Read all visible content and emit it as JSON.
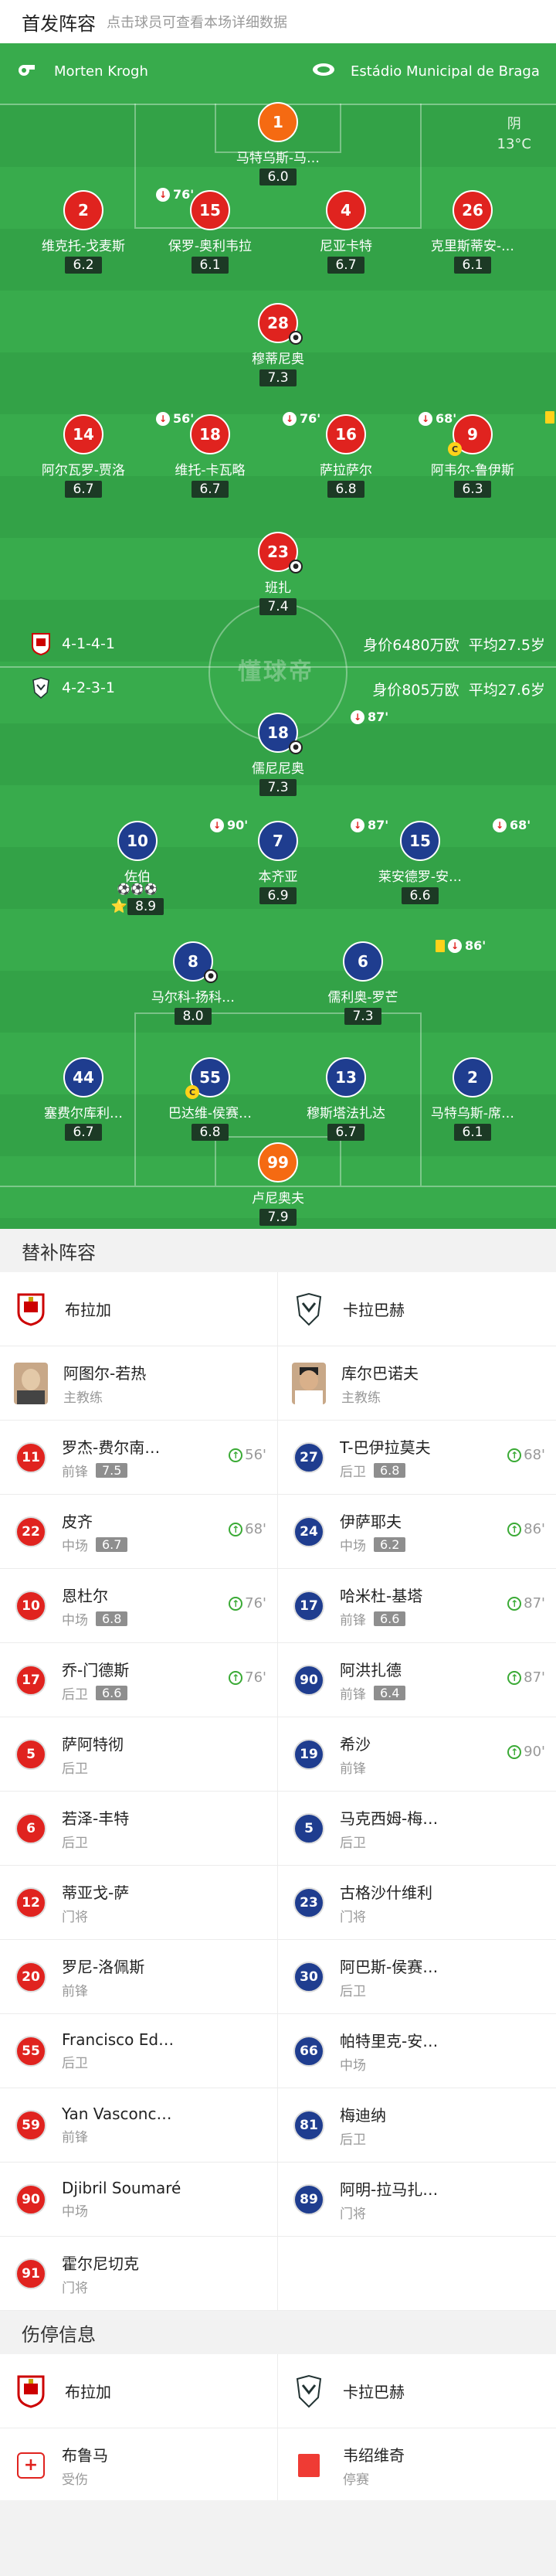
{
  "header": {
    "title": "首发阵容",
    "subtitle": "点击球员可查看本场详细数据"
  },
  "pitch": {
    "home_coach": "Morten Krogh",
    "venue": "Estádio Municipal de Braga",
    "weather": "阴",
    "temperature": "13°C",
    "watermark": "懂球帝",
    "home_formation": "4-1-4-1",
    "home_value": "身价6480万欧",
    "home_age": "平均27.5岁",
    "away_formation": "4-2-3-1",
    "away_value": "身价805万欧",
    "away_age": "平均27.6岁"
  },
  "home_players": [
    {
      "num": "1",
      "name": "马特乌斯-马…",
      "rating": "6.0",
      "color": "org"
    },
    {
      "num": "2",
      "name": "维克托-戈麦斯",
      "rating": "6.2",
      "sub": "76'"
    },
    {
      "num": "15",
      "name": "保罗-奥利韦拉",
      "rating": "6.1"
    },
    {
      "num": "4",
      "name": "尼亚卡特",
      "rating": "6.7"
    },
    {
      "num": "26",
      "name": "克里斯蒂安-…",
      "rating": "6.1"
    },
    {
      "num": "28",
      "name": "穆蒂尼奥",
      "rating": "7.3",
      "goal": true
    },
    {
      "num": "14",
      "name": "阿尔瓦罗-贾洛",
      "rating": "6.7",
      "sub": "56'"
    },
    {
      "num": "18",
      "name": "维托-卡瓦略",
      "rating": "6.7",
      "sub": "76'"
    },
    {
      "num": "16",
      "name": "萨拉萨尔",
      "rating": "6.8",
      "sub": "68'"
    },
    {
      "num": "9",
      "name": "阿韦尔-鲁伊斯",
      "rating": "6.3",
      "yellow": true,
      "captain": true
    },
    {
      "num": "23",
      "name": "班扎",
      "rating": "7.4",
      "goal": true
    }
  ],
  "away_players": [
    {
      "num": "18",
      "name": "儒尼尼奥",
      "rating": "7.3",
      "sub": "87'",
      "goal": true
    },
    {
      "num": "10",
      "name": "佐伯",
      "rating": "8.9",
      "sub": "90'",
      "goals": "⚽⚽⚽",
      "star": "⭐"
    },
    {
      "num": "7",
      "name": "本齐亚",
      "rating": "6.9",
      "sub": "87'"
    },
    {
      "num": "15",
      "name": "莱安德罗-安…",
      "rating": "6.6",
      "sub": "68'"
    },
    {
      "num": "8",
      "name": "马尔科-扬科…",
      "rating": "8.0",
      "goal": true
    },
    {
      "num": "6",
      "name": "儒利奥-罗芒",
      "rating": "7.3",
      "sub": "86'",
      "yellow": true
    },
    {
      "num": "44",
      "name": "塞费尔库利…",
      "rating": "6.7"
    },
    {
      "num": "55",
      "name": "巴达维-侯赛…",
      "rating": "6.8",
      "captain": true
    },
    {
      "num": "13",
      "name": "穆斯塔法扎达",
      "rating": "6.7"
    },
    {
      "num": "2",
      "name": "马特乌斯-席…",
      "rating": "6.1"
    },
    {
      "num": "99",
      "name": "卢尼奥夫",
      "rating": "7.9",
      "color": "org"
    }
  ],
  "subs_title": "替补阵容",
  "teams": {
    "home": "布拉加",
    "away": "卡拉巴赫"
  },
  "coaches": {
    "home_name": "阿图尔-若热",
    "away_name": "库尔巴诺夫",
    "role": "主教练"
  },
  "subs_home": [
    {
      "num": "11",
      "name": "罗杰-费尔南…",
      "pos": "前锋",
      "rating": "7.5",
      "min": "56'"
    },
    {
      "num": "22",
      "name": "皮齐",
      "pos": "中场",
      "rating": "6.7",
      "min": "68'"
    },
    {
      "num": "10",
      "name": "恩杜尔",
      "pos": "中场",
      "rating": "6.8",
      "min": "76'"
    },
    {
      "num": "17",
      "name": "乔-门德斯",
      "pos": "后卫",
      "rating": "6.6",
      "min": "76'"
    },
    {
      "num": "5",
      "name": "萨阿特彻",
      "pos": "后卫"
    },
    {
      "num": "6",
      "name": "若泽-丰特",
      "pos": "后卫"
    },
    {
      "num": "12",
      "name": "蒂亚戈-萨",
      "pos": "门将"
    },
    {
      "num": "20",
      "name": "罗尼-洛佩斯",
      "pos": "前锋"
    },
    {
      "num": "55",
      "name": "Francisco Ed…",
      "pos": "后卫"
    },
    {
      "num": "59",
      "name": "Yan Vasconc…",
      "pos": "前锋"
    },
    {
      "num": "90",
      "name": "Djibril Soumaré",
      "pos": "中场"
    },
    {
      "num": "91",
      "name": "霍尔尼切克",
      "pos": "门将"
    }
  ],
  "subs_away": [
    {
      "num": "27",
      "name": "T-巴伊拉莫夫",
      "pos": "后卫",
      "rating": "6.8",
      "min": "68'"
    },
    {
      "num": "24",
      "name": "伊萨耶夫",
      "pos": "中场",
      "rating": "6.2",
      "min": "86'"
    },
    {
      "num": "17",
      "name": "哈米杜-基塔",
      "pos": "前锋",
      "rating": "6.6",
      "min": "87'"
    },
    {
      "num": "90",
      "name": "阿洪扎德",
      "pos": "前锋",
      "rating": "6.4",
      "min": "87'"
    },
    {
      "num": "19",
      "name": "希沙",
      "pos": "前锋",
      "min": "90'"
    },
    {
      "num": "5",
      "name": "马克西姆-梅…",
      "pos": "后卫"
    },
    {
      "num": "23",
      "name": "古格沙什维利",
      "pos": "门将"
    },
    {
      "num": "30",
      "name": "阿巴斯-侯赛…",
      "pos": "后卫"
    },
    {
      "num": "66",
      "name": "帕特里克-安…",
      "pos": "中场"
    },
    {
      "num": "81",
      "name": "梅迪纳",
      "pos": "后卫"
    },
    {
      "num": "89",
      "name": "阿明-拉马扎…",
      "pos": "门将"
    }
  ],
  "injury_title": "伤停信息",
  "injuries": {
    "home": {
      "name": "布鲁马",
      "status": "受伤"
    },
    "away": {
      "name": "韦绍维奇",
      "status": "停赛"
    }
  },
  "colors": {
    "pitch": "#36a84a",
    "home": "#e0231f",
    "away": "#1f3d8f",
    "gk": "#f56a12",
    "sub_up": "#3aaa35"
  }
}
